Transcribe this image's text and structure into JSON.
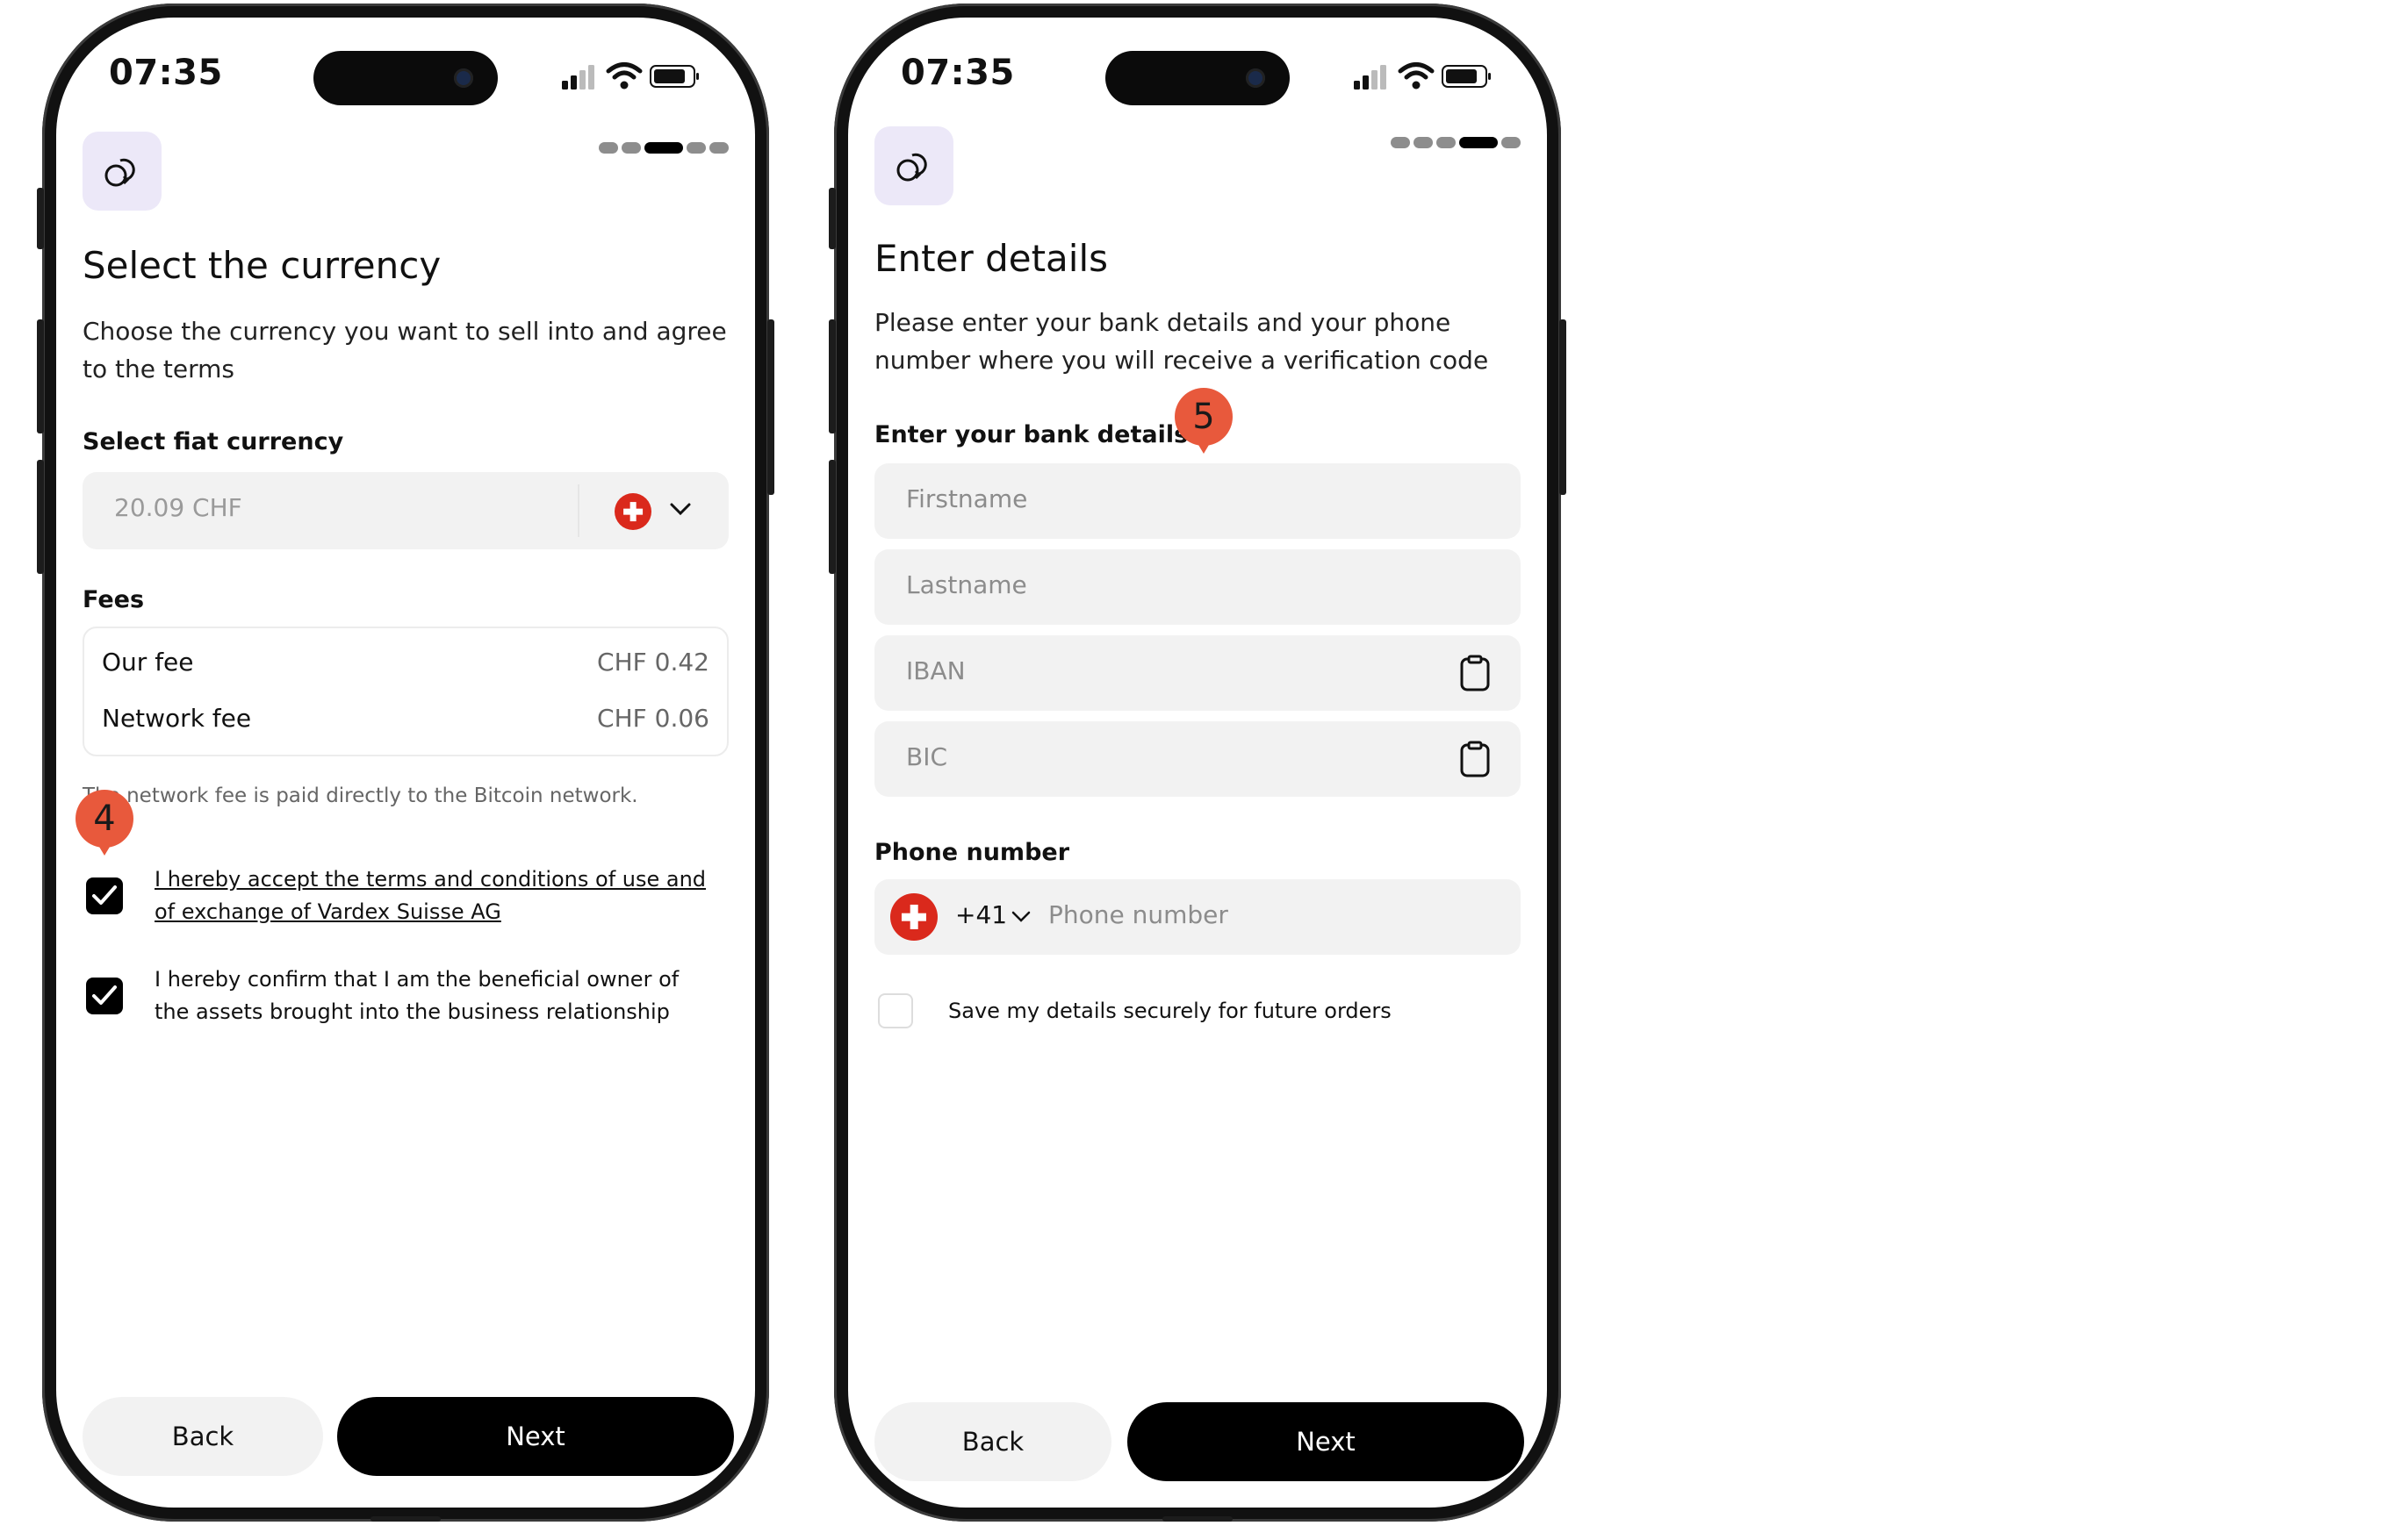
{
  "colors": {
    "accent_badge": "#e8593c",
    "primary_button": "#000000",
    "field_bg": "#f2f2f2",
    "icon_bg": "#ece8f8",
    "swiss_red": "#da291c"
  },
  "left_screen": {
    "time": "07:35",
    "title": "Select the currency",
    "subtitle": "Choose the currency you want to sell into and agree to the terms",
    "currency_label": "Select fiat currency",
    "currency_value": "20.09 CHF",
    "fees_label": "Fees",
    "fees": [
      {
        "name": "Our fee",
        "value": "CHF 0.42"
      },
      {
        "name": "Network fee",
        "value": "CHF 0.06"
      }
    ],
    "network_note": "The network fee is paid directly to the Bitcoin network.",
    "terms_checkbox": {
      "label": "I hereby accept the terms and conditions of use and of exchange of Vardex Suisse AG",
      "checked": true
    },
    "owner_checkbox": {
      "label": "I hereby confirm that I am the beneficial owner of the assets brought into the business relationship",
      "checked": true
    },
    "badge": "4",
    "back_label": "Back",
    "next_label": "Next"
  },
  "right_screen": {
    "time": "07:35",
    "title": "Enter details",
    "subtitle": "Please enter your bank details and your phone number where you will receive a verification code",
    "bank_label": "Enter your bank details",
    "badge": "5",
    "fields": {
      "firstname_placeholder": "Firstname",
      "lastname_placeholder": "Lastname",
      "iban_placeholder": "IBAN",
      "bic_placeholder": "BIC"
    },
    "phone_label": "Phone number",
    "country_code": "+41",
    "phone_placeholder": "Phone number",
    "save_checkbox": {
      "label": "Save my details securely for future orders",
      "checked": false
    },
    "back_label": "Back",
    "next_label": "Next"
  }
}
